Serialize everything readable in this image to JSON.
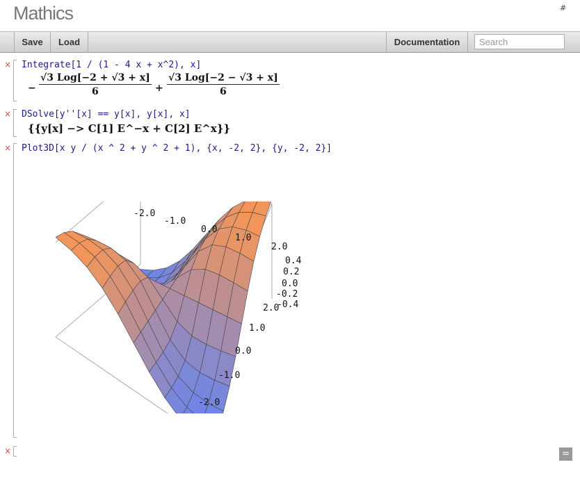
{
  "app": {
    "title": "Mathics",
    "hash_link": "#"
  },
  "toolbar": {
    "save": "Save",
    "load": "Load",
    "documentation": "Documentation",
    "search_placeholder": "Search"
  },
  "cells": [
    {
      "input": "Integrate[1 / (1 - 4 x + x^2), x]",
      "output": {
        "term1_num": "√3 Log[−2 + √3 + x]",
        "term1_den": "6",
        "term2_num": "√3 Log[−2 − √3 + x]",
        "term2_den": "6",
        "minus": "−",
        "plus": "+"
      }
    },
    {
      "input": "DSolve[y''[x] == y[x], y[x], x]",
      "output": "{{y[x] −> C[1] E^−x + C[2] E^x}}"
    },
    {
      "input": "Plot3D[x y / (x ^ 2 + y ^ 2 + 1), {x, -2, 2}, {y, -2, 2}]"
    }
  ],
  "chart_data": {
    "type": "surface3d",
    "function": "x y / (x ^ 2 + y ^ 2 + 1)",
    "x_range": [
      -2,
      2
    ],
    "y_range": [
      -2,
      2
    ],
    "z_range": [
      -0.4,
      0.4
    ],
    "x_ticks": [
      "-2.0",
      "-1.0",
      "0.0",
      "1.0",
      "2.0"
    ],
    "y_ticks": [
      "2.0",
      "1.0",
      "0.0",
      "-1.0",
      "-2.0"
    ],
    "z_ticks": [
      "0.4",
      "0.2",
      "0.0",
      "-0.2",
      "-0.4"
    ],
    "colors": {
      "low": "#6f86e6",
      "high": "#f2955a"
    }
  },
  "equals_label": "=",
  "close_glyph": "×"
}
